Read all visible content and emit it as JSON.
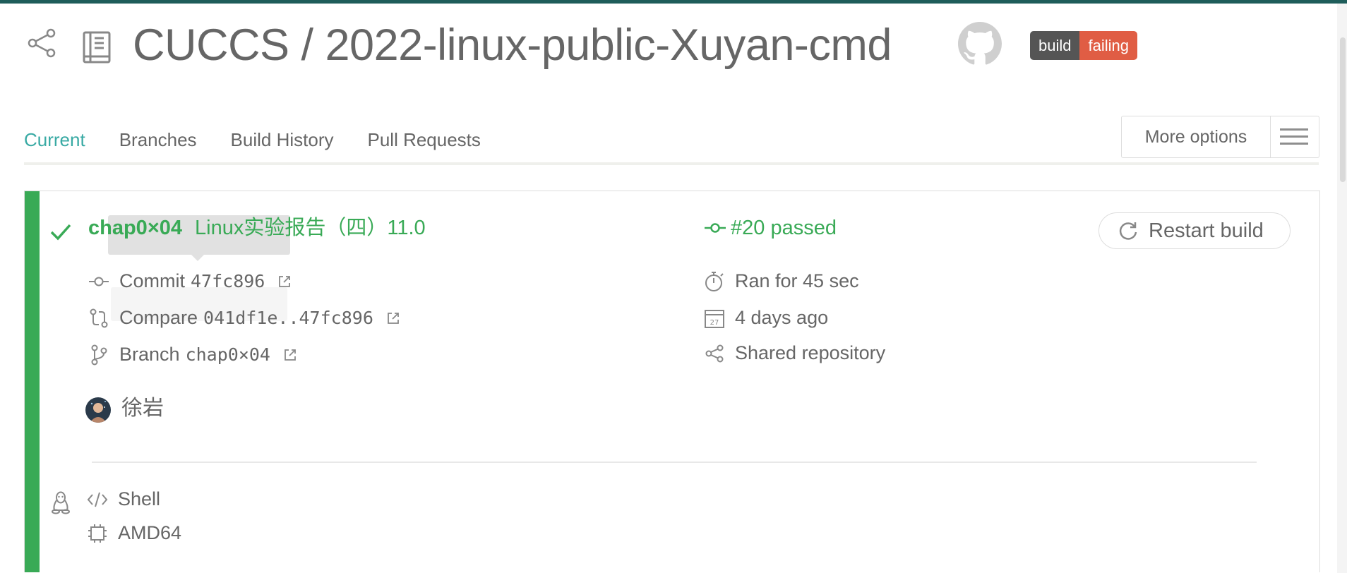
{
  "header": {
    "repo_title": "CUCCS / 2022-linux-public-Xuyan-cmd",
    "badge": {
      "left": "build",
      "right": "failing"
    }
  },
  "tabs": [
    {
      "label": "Current",
      "active": true
    },
    {
      "label": "Branches",
      "active": false
    },
    {
      "label": "Build History",
      "active": false
    },
    {
      "label": "Pull Requests",
      "active": false
    }
  ],
  "more_options": {
    "label": "More options"
  },
  "build": {
    "branch": "chap0×04",
    "message": "Linux实验报告（四）11.0",
    "status": "#20 passed",
    "restart_label": "Restart build",
    "commit": {
      "label": "Commit",
      "hash": "47fc896"
    },
    "compare": {
      "label": "Compare",
      "range": "041df1e..47fc896"
    },
    "branch_row": {
      "label": "Branch",
      "name": "chap0×04"
    },
    "duration": "Ran for 45 sec",
    "finished": "4 days ago",
    "calendar_day": "27",
    "shared": "Shared repository",
    "author": "徐岩",
    "language": "Shell",
    "arch": "AMD64"
  },
  "colors": {
    "accent": "#39aaa4",
    "passed": "#39aa56",
    "badge_failing": "#e05d44",
    "badge_label": "#555555",
    "topbar": "#1e5d5a"
  }
}
